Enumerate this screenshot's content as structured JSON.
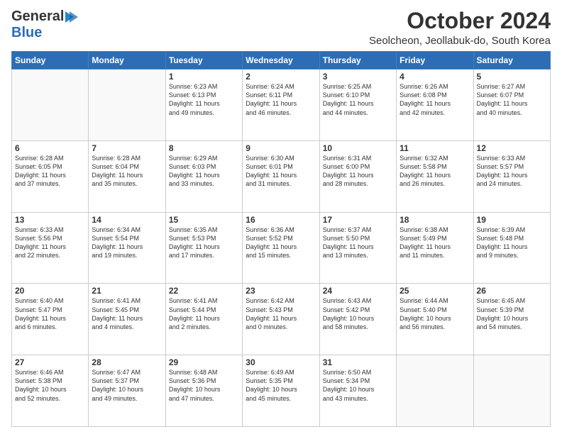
{
  "header": {
    "logo_line1": "General",
    "logo_line2": "Blue",
    "month": "October 2024",
    "location": "Seolcheon, Jeollabuk-do, South Korea"
  },
  "days_of_week": [
    "Sunday",
    "Monday",
    "Tuesday",
    "Wednesday",
    "Thursday",
    "Friday",
    "Saturday"
  ],
  "weeks": [
    [
      {
        "day": "",
        "info": ""
      },
      {
        "day": "",
        "info": ""
      },
      {
        "day": "1",
        "info": "Sunrise: 6:23 AM\nSunset: 6:13 PM\nDaylight: 11 hours\nand 49 minutes."
      },
      {
        "day": "2",
        "info": "Sunrise: 6:24 AM\nSunset: 6:11 PM\nDaylight: 11 hours\nand 46 minutes."
      },
      {
        "day": "3",
        "info": "Sunrise: 6:25 AM\nSunset: 6:10 PM\nDaylight: 11 hours\nand 44 minutes."
      },
      {
        "day": "4",
        "info": "Sunrise: 6:26 AM\nSunset: 6:08 PM\nDaylight: 11 hours\nand 42 minutes."
      },
      {
        "day": "5",
        "info": "Sunrise: 6:27 AM\nSunset: 6:07 PM\nDaylight: 11 hours\nand 40 minutes."
      }
    ],
    [
      {
        "day": "6",
        "info": "Sunrise: 6:28 AM\nSunset: 6:05 PM\nDaylight: 11 hours\nand 37 minutes."
      },
      {
        "day": "7",
        "info": "Sunrise: 6:28 AM\nSunset: 6:04 PM\nDaylight: 11 hours\nand 35 minutes."
      },
      {
        "day": "8",
        "info": "Sunrise: 6:29 AM\nSunset: 6:03 PM\nDaylight: 11 hours\nand 33 minutes."
      },
      {
        "day": "9",
        "info": "Sunrise: 6:30 AM\nSunset: 6:01 PM\nDaylight: 11 hours\nand 31 minutes."
      },
      {
        "day": "10",
        "info": "Sunrise: 6:31 AM\nSunset: 6:00 PM\nDaylight: 11 hours\nand 28 minutes."
      },
      {
        "day": "11",
        "info": "Sunrise: 6:32 AM\nSunset: 5:58 PM\nDaylight: 11 hours\nand 26 minutes."
      },
      {
        "day": "12",
        "info": "Sunrise: 6:33 AM\nSunset: 5:57 PM\nDaylight: 11 hours\nand 24 minutes."
      }
    ],
    [
      {
        "day": "13",
        "info": "Sunrise: 6:33 AM\nSunset: 5:56 PM\nDaylight: 11 hours\nand 22 minutes."
      },
      {
        "day": "14",
        "info": "Sunrise: 6:34 AM\nSunset: 5:54 PM\nDaylight: 11 hours\nand 19 minutes."
      },
      {
        "day": "15",
        "info": "Sunrise: 6:35 AM\nSunset: 5:53 PM\nDaylight: 11 hours\nand 17 minutes."
      },
      {
        "day": "16",
        "info": "Sunrise: 6:36 AM\nSunset: 5:52 PM\nDaylight: 11 hours\nand 15 minutes."
      },
      {
        "day": "17",
        "info": "Sunrise: 6:37 AM\nSunset: 5:50 PM\nDaylight: 11 hours\nand 13 minutes."
      },
      {
        "day": "18",
        "info": "Sunrise: 6:38 AM\nSunset: 5:49 PM\nDaylight: 11 hours\nand 11 minutes."
      },
      {
        "day": "19",
        "info": "Sunrise: 6:39 AM\nSunset: 5:48 PM\nDaylight: 11 hours\nand 9 minutes."
      }
    ],
    [
      {
        "day": "20",
        "info": "Sunrise: 6:40 AM\nSunset: 5:47 PM\nDaylight: 11 hours\nand 6 minutes."
      },
      {
        "day": "21",
        "info": "Sunrise: 6:41 AM\nSunset: 5:45 PM\nDaylight: 11 hours\nand 4 minutes."
      },
      {
        "day": "22",
        "info": "Sunrise: 6:41 AM\nSunset: 5:44 PM\nDaylight: 11 hours\nand 2 minutes."
      },
      {
        "day": "23",
        "info": "Sunrise: 6:42 AM\nSunset: 5:43 PM\nDaylight: 11 hours\nand 0 minutes."
      },
      {
        "day": "24",
        "info": "Sunrise: 6:43 AM\nSunset: 5:42 PM\nDaylight: 10 hours\nand 58 minutes."
      },
      {
        "day": "25",
        "info": "Sunrise: 6:44 AM\nSunset: 5:40 PM\nDaylight: 10 hours\nand 56 minutes."
      },
      {
        "day": "26",
        "info": "Sunrise: 6:45 AM\nSunset: 5:39 PM\nDaylight: 10 hours\nand 54 minutes."
      }
    ],
    [
      {
        "day": "27",
        "info": "Sunrise: 6:46 AM\nSunset: 5:38 PM\nDaylight: 10 hours\nand 52 minutes."
      },
      {
        "day": "28",
        "info": "Sunrise: 6:47 AM\nSunset: 5:37 PM\nDaylight: 10 hours\nand 49 minutes."
      },
      {
        "day": "29",
        "info": "Sunrise: 6:48 AM\nSunset: 5:36 PM\nDaylight: 10 hours\nand 47 minutes."
      },
      {
        "day": "30",
        "info": "Sunrise: 6:49 AM\nSunset: 5:35 PM\nDaylight: 10 hours\nand 45 minutes."
      },
      {
        "day": "31",
        "info": "Sunrise: 6:50 AM\nSunset: 5:34 PM\nDaylight: 10 hours\nand 43 minutes."
      },
      {
        "day": "",
        "info": ""
      },
      {
        "day": "",
        "info": ""
      }
    ]
  ]
}
